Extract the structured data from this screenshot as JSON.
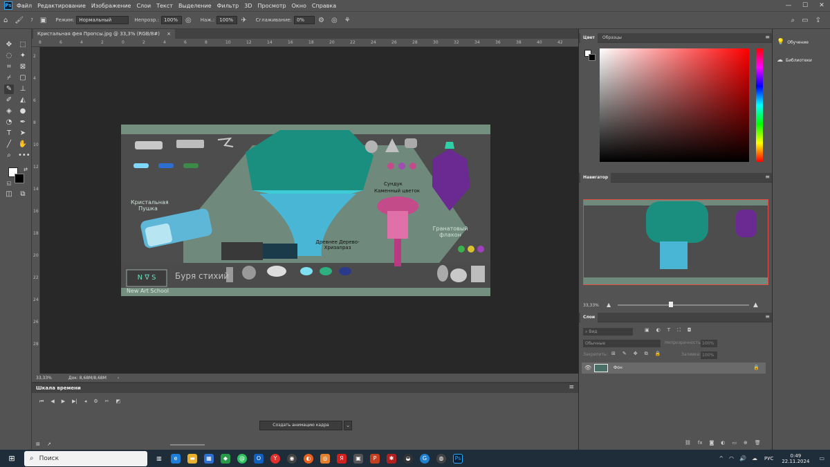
{
  "menubar": {
    "app_icon": "Ps",
    "items": [
      "Файл",
      "Редактирование",
      "Изображение",
      "Слои",
      "Текст",
      "Выделение",
      "Фильтр",
      "3D",
      "Просмотр",
      "Окно",
      "Справка"
    ]
  },
  "options": {
    "brush_size": "7",
    "mode_label": "Режим:",
    "mode_value": "Нормальный",
    "opacity_label": "Непрозр.:",
    "opacity_value": "100%",
    "pressure_label": "Наж.:",
    "pressure_value": "100%",
    "smoothing_label": "Сглаживание:",
    "smoothing_value": "0%"
  },
  "document": {
    "tab_title": "Кристальная фея Пропсы.jpg @ 33,3% (RGB/8#)",
    "zoom": "33,33%",
    "doc_size": "Док: 8,68M/8,68M",
    "ruler_ticks": [
      "8",
      "6",
      "4",
      "2",
      "0",
      "2",
      "4",
      "6",
      "8",
      "10",
      "12",
      "14",
      "16",
      "18",
      "20",
      "22",
      "24",
      "26",
      "28",
      "30",
      "32",
      "34",
      "36",
      "38",
      "40",
      "42"
    ],
    "ruler_v_ticks": [
      "2",
      "4",
      "6",
      "8",
      "10",
      "12",
      "14",
      "16",
      "18",
      "20",
      "22",
      "24",
      "26",
      "28"
    ]
  },
  "artwork": {
    "crystal_cannon": "Кристальная Пушка",
    "ancient_tree": "Древнее Дерево-Хризапраз",
    "stone_flower_1": "Сундук",
    "stone_flower_2": "Каменный цветок",
    "garnet_flask": "Гранатовый флакон",
    "logo_text": "N ∇ S",
    "storm_label": "Буря стихий",
    "school": "New Art School"
  },
  "timeline": {
    "title": "Шкала времени",
    "create_button": "Создать анимацию кадра"
  },
  "panels": {
    "color_tab": "Цвет",
    "swatches_tab": "Образцы",
    "navigator_tab": "Навигатор",
    "nav_zoom": "33,33%",
    "layers_tab": "Слои",
    "search_placeholder": "Вид",
    "blend_mode": "Обычные",
    "opacity_label": "Непрозрачность:",
    "opacity_value": "100%",
    "lock_label": "Закрепить:",
    "fill_label": "Заливка:",
    "fill_value": "100%",
    "layer_name": "Фон"
  },
  "farright": {
    "learn": "Обучение",
    "libraries": "Библиотеки"
  },
  "taskbar": {
    "search": "Поиск",
    "lang": "РУС",
    "time": "0:49",
    "date": "22.11.2024"
  },
  "colors": {
    "accent_red": "#e84c3d",
    "ps_blue": "#31a8ff"
  }
}
